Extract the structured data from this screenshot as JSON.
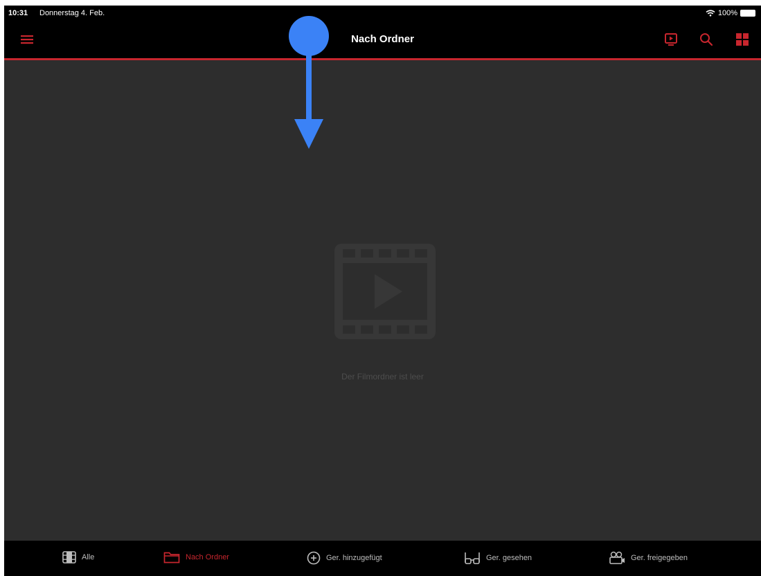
{
  "status_bar": {
    "time": "10:31",
    "date": "Donnerstag 4. Feb.",
    "battery": "100%"
  },
  "nav": {
    "title": "Nach Ordner"
  },
  "empty_state": {
    "message": "Der Filmordner ist leer"
  },
  "tabs": [
    {
      "label": "Alle",
      "icon": "film-strip-icon",
      "active": false
    },
    {
      "label": "Nach Ordner",
      "icon": "folder-icon",
      "active": true
    },
    {
      "label": "Ger. hinzugefügt",
      "icon": "plus-circle-icon",
      "active": false
    },
    {
      "label": "Ger. gesehen",
      "icon": "glasses-icon",
      "active": false
    },
    {
      "label": "Ger. freigegeben",
      "icon": "camera-icon",
      "active": false
    }
  ],
  "colors": {
    "accent": "#c8262e",
    "gesture": "#3b82f6"
  }
}
